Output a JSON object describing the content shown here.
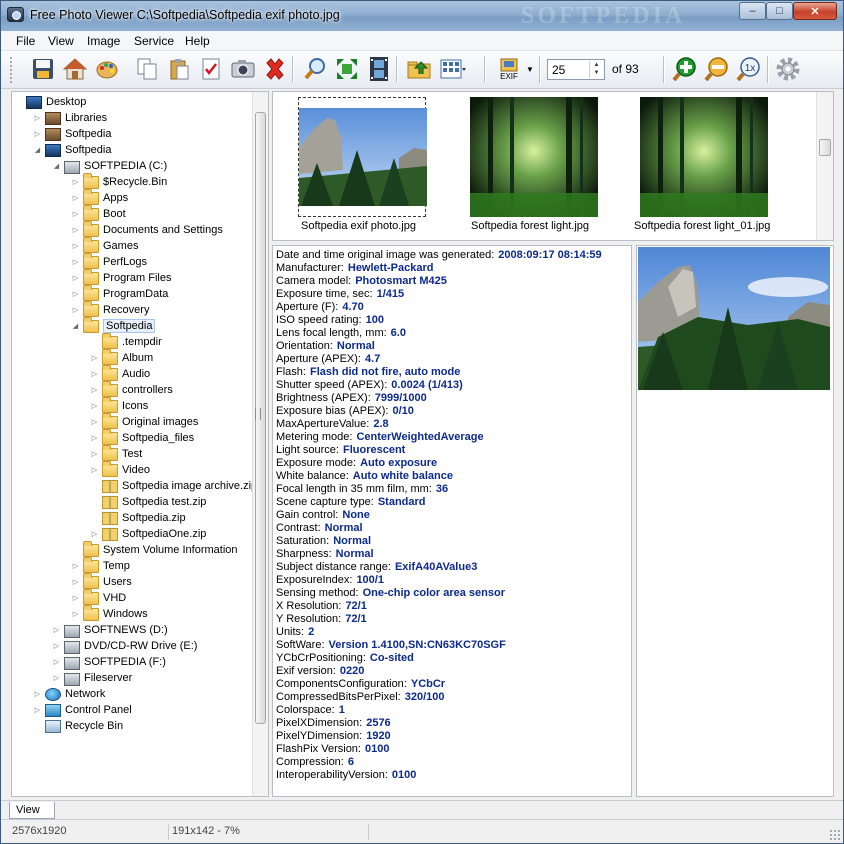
{
  "window": {
    "title": "Free Photo Viewer C:\\Softpedia\\Softpedia exif photo.jpg",
    "watermark": "SOFTPEDIA",
    "controls": {
      "minimize": "–",
      "maximize": "□",
      "close": "✕"
    }
  },
  "menu": [
    "File",
    "View",
    "Image",
    "Service",
    "Help"
  ],
  "toolbar": {
    "buttons": [
      "save-icon",
      "home-icon",
      "palette-icon",
      "copy-icon",
      "paste-icon",
      "checklist-icon",
      "scan-icon",
      "delete-icon",
      "search-icon",
      "fullscreen-icon",
      "filmstrip-icon",
      "folder-up-icon",
      "thumbnail-view-icon",
      "exif-icon",
      "zoom-in-icon",
      "zoom-out-icon",
      "zoom-1x-icon",
      "settings-icon"
    ],
    "exif_label": "EXIF",
    "zoom_1x_label": "1x",
    "page_value": "25",
    "page_total": "of 93"
  },
  "tree": [
    {
      "label": "Desktop",
      "icon": "desktop-icon",
      "level": 0,
      "exp": ""
    },
    {
      "label": "Libraries",
      "icon": "library-icon",
      "level": 1,
      "exp": "▷"
    },
    {
      "label": "Softpedia",
      "icon": "user-folder-icon",
      "level": 1,
      "exp": "▷"
    },
    {
      "label": "Softpedia",
      "icon": "computer-icon",
      "level": 1,
      "exp": "◢"
    },
    {
      "label": "SOFTPEDIA (C:)",
      "icon": "drive-icon",
      "level": 2,
      "exp": "◢"
    },
    {
      "label": "$Recycle.Bin",
      "icon": "folder-icon",
      "level": 3,
      "exp": "▷"
    },
    {
      "label": "Apps",
      "icon": "folder-icon",
      "level": 3,
      "exp": "▷"
    },
    {
      "label": "Boot",
      "icon": "folder-icon",
      "level": 3,
      "exp": "▷"
    },
    {
      "label": "Documents and Settings",
      "icon": "folder-icon",
      "level": 3,
      "exp": "▷"
    },
    {
      "label": "Games",
      "icon": "folder-icon",
      "level": 3,
      "exp": "▷"
    },
    {
      "label": "PerfLogs",
      "icon": "folder-icon",
      "level": 3,
      "exp": "▷"
    },
    {
      "label": "Program Files",
      "icon": "folder-icon",
      "level": 3,
      "exp": "▷"
    },
    {
      "label": "ProgramData",
      "icon": "folder-icon",
      "level": 3,
      "exp": "▷"
    },
    {
      "label": "Recovery",
      "icon": "folder-icon",
      "level": 3,
      "exp": "▷"
    },
    {
      "label": "Softpedia",
      "icon": "folder-icon",
      "level": 3,
      "exp": "◢",
      "selected": true
    },
    {
      "label": ".tempdir",
      "icon": "folder-icon",
      "level": 4,
      "exp": ""
    },
    {
      "label": "Album",
      "icon": "folder-icon",
      "level": 4,
      "exp": "▷"
    },
    {
      "label": "Audio",
      "icon": "folder-icon",
      "level": 4,
      "exp": "▷"
    },
    {
      "label": "controllers",
      "icon": "folder-icon",
      "level": 4,
      "exp": "▷"
    },
    {
      "label": "Icons",
      "icon": "folder-icon",
      "level": 4,
      "exp": "▷"
    },
    {
      "label": "Original images",
      "icon": "folder-icon",
      "level": 4,
      "exp": "▷"
    },
    {
      "label": "Softpedia_files",
      "icon": "folder-icon",
      "level": 4,
      "exp": "▷"
    },
    {
      "label": "Test",
      "icon": "folder-icon",
      "level": 4,
      "exp": "▷"
    },
    {
      "label": "Video",
      "icon": "folder-icon",
      "level": 4,
      "exp": "▷"
    },
    {
      "label": "Softpedia image archive.zip",
      "icon": "zip-folder-icon",
      "level": 4,
      "exp": ""
    },
    {
      "label": "Softpedia test.zip",
      "icon": "zip-folder-icon",
      "level": 4,
      "exp": ""
    },
    {
      "label": "Softpedia.zip",
      "icon": "zip-folder-icon",
      "level": 4,
      "exp": ""
    },
    {
      "label": "SoftpediaOne.zip",
      "icon": "zip-folder-icon",
      "level": 4,
      "exp": "▷"
    },
    {
      "label": "System Volume Information",
      "icon": "folder-icon",
      "level": 3,
      "exp": ""
    },
    {
      "label": "Temp",
      "icon": "folder-icon",
      "level": 3,
      "exp": "▷"
    },
    {
      "label": "Users",
      "icon": "folder-icon",
      "level": 3,
      "exp": "▷"
    },
    {
      "label": "VHD",
      "icon": "folder-icon",
      "level": 3,
      "exp": "▷"
    },
    {
      "label": "Windows",
      "icon": "folder-icon",
      "level": 3,
      "exp": "▷"
    },
    {
      "label": "SOFTNEWS (D:)",
      "icon": "drive-icon",
      "level": 2,
      "exp": "▷"
    },
    {
      "label": "DVD/CD-RW Drive (E:)",
      "icon": "optical-drive-icon",
      "level": 2,
      "exp": "▷"
    },
    {
      "label": "SOFTPEDIA (F:)",
      "icon": "drive-icon",
      "level": 2,
      "exp": "▷"
    },
    {
      "label": "Fileserver",
      "icon": "network-drive-icon",
      "level": 2,
      "exp": "▷"
    },
    {
      "label": "Network",
      "icon": "network-icon",
      "level": 1,
      "exp": "▷"
    },
    {
      "label": "Control Panel",
      "icon": "control-panel-icon",
      "level": 1,
      "exp": "▷"
    },
    {
      "label": "Recycle Bin",
      "icon": "recycle-bin-icon",
      "level": 1,
      "exp": ""
    }
  ],
  "thumbnails": [
    {
      "label": "Softpedia exif photo.jpg",
      "kind": "mountain",
      "selected": true
    },
    {
      "label": "Softpedia forest light.jpg",
      "kind": "forest",
      "selected": false
    },
    {
      "label": "Softpedia forest light_01.jpg",
      "kind": "forest",
      "selected": false
    }
  ],
  "exif": [
    {
      "k": "Date and time original image was generated:",
      "v": "2008:09:17 08:14:59"
    },
    {
      "k": "Manufacturer:",
      "v": "Hewlett-Packard"
    },
    {
      "k": "Camera model:",
      "v": "Photosmart M425"
    },
    {
      "k": "Exposure time, sec:",
      "v": "1/415"
    },
    {
      "k": "Aperture (F):",
      "v": "4.70"
    },
    {
      "k": "ISO speed rating:",
      "v": "100"
    },
    {
      "k": "Lens focal length, mm:",
      "v": "6.0"
    },
    {
      "k": "Orientation:",
      "v": "Normal"
    },
    {
      "k": "Aperture (APEX):",
      "v": "4.7"
    },
    {
      "k": "Flash:",
      "v": "Flash did not fire, auto mode"
    },
    {
      "k": "Shutter speed (APEX):",
      "v": "0.0024 (1/413)"
    },
    {
      "k": "Brightness (APEX):",
      "v": "7999/1000"
    },
    {
      "k": "Exposure bias (APEX):",
      "v": "0/10"
    },
    {
      "k": "MaxApertureValue:",
      "v": "2.8"
    },
    {
      "k": "Metering mode:",
      "v": "CenterWeightedAverage"
    },
    {
      "k": "Light source:",
      "v": "Fluorescent"
    },
    {
      "k": "Exposure mode:",
      "v": "Auto exposure"
    },
    {
      "k": "White balance:",
      "v": "Auto white balance"
    },
    {
      "k": "Focal length in 35 mm film, mm:",
      "v": "36"
    },
    {
      "k": "Scene capture type:",
      "v": "Standard"
    },
    {
      "k": "Gain control:",
      "v": "None"
    },
    {
      "k": "Contrast:",
      "v": "Normal"
    },
    {
      "k": "Saturation:",
      "v": "Normal"
    },
    {
      "k": "Sharpness:",
      "v": "Normal"
    },
    {
      "k": "Subject distance range:",
      "v": "ExifA40AValue3"
    },
    {
      "k": "ExposureIndex:",
      "v": "100/1"
    },
    {
      "k": "Sensing method:",
      "v": "One-chip color area sensor"
    },
    {
      "k": "X Resolution:",
      "v": "72/1"
    },
    {
      "k": "Y Resolution:",
      "v": "72/1"
    },
    {
      "k": "Units:",
      "v": "2"
    },
    {
      "k": "SoftWare:",
      "v": "Version 1.4100,SN:CN63KC70SGF"
    },
    {
      "k": "YCbCrPositioning:",
      "v": "Co-sited"
    },
    {
      "k": "Exif version:",
      "v": "0220"
    },
    {
      "k": "ComponentsConfiguration:",
      "v": "YCbCr"
    },
    {
      "k": "CompressedBitsPerPixel:",
      "v": "320/100"
    },
    {
      "k": "Colorspace:",
      "v": "1"
    },
    {
      "k": "PixelXDimension:",
      "v": "2576"
    },
    {
      "k": "PixelYDimension:",
      "v": "1920"
    },
    {
      "k": "FlashPix Version:",
      "v": "0100"
    },
    {
      "k": "Compression:",
      "v": "6"
    },
    {
      "k": "InteroperabilityVersion:",
      "v": "0100"
    }
  ],
  "tab": "View",
  "status": {
    "dimensions": "2576x1920",
    "view_info": "191x142 - 7%"
  }
}
